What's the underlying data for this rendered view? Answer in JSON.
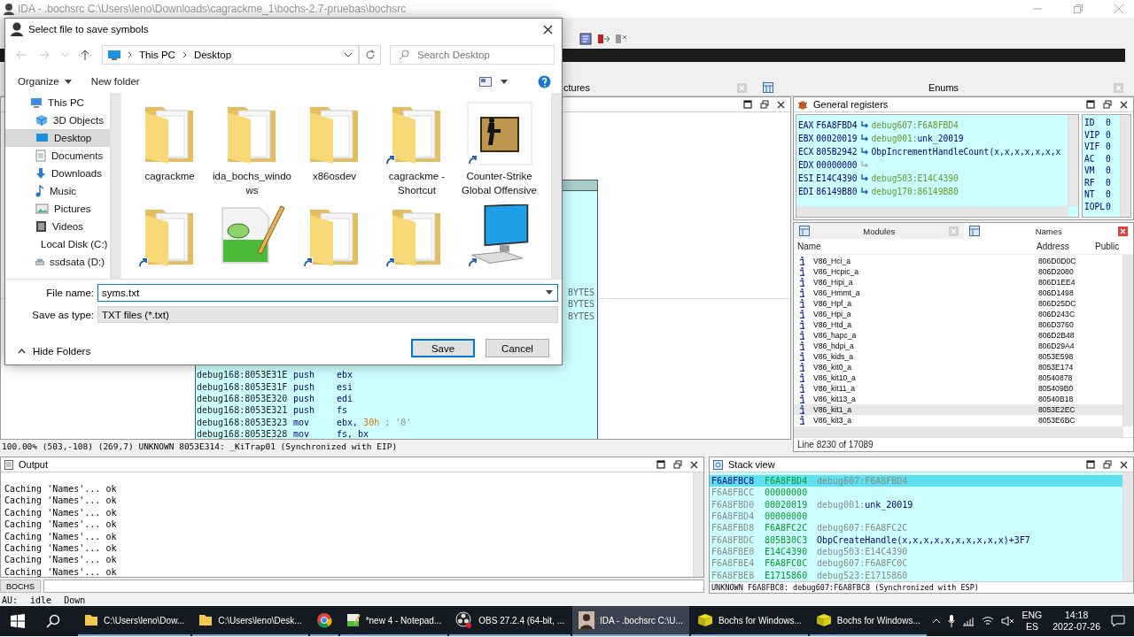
{
  "window": {
    "title": "IDA - .bochsrc C:\\Users\\leno\\Downloads\\cagrackme_1\\bochs-2.7-pruebas\\bochsrc"
  },
  "panel_tabs": [
    {
      "label": "ctures"
    },
    {
      "label": "Enums"
    }
  ],
  "disassembly": {
    "bytes_lines": [
      "BYTES",
      "BYTES",
      "BYTES"
    ],
    "lines": [
      {
        "address": "debug168:8053E31E",
        "mnemonic": "push",
        "operands": "ebx"
      },
      {
        "address": "debug168:8053E31F",
        "mnemonic": "push",
        "operands": "esi"
      },
      {
        "address": "debug168:8053E320",
        "mnemonic": "push",
        "operands": "edi"
      },
      {
        "address": "debug168:8053E321",
        "mnemonic": "push",
        "operands": "fs"
      },
      {
        "address": "debug168:8053E323",
        "mnemonic": "mov",
        "operands": "ebx, ",
        "immediate": "30h",
        "comment": " ; '0'"
      },
      {
        "address": "debug168:8053E328",
        "mnemonic": "mov",
        "operands": "fs, bx"
      }
    ],
    "status": "100.00% (503,-108) (269,7) UNKNOWN 8053E314: _KiTrap01 (Synchronized with EIP)"
  },
  "registers": {
    "title": "General registers",
    "rows": [
      {
        "name": "EAX",
        "value": "F6A8FBD4",
        "ref": [
          {
            "text": "debug607:F6A8FBD4",
            "kind": "data"
          }
        ]
      },
      {
        "name": "EBX",
        "value": "00020019",
        "ref": [
          {
            "text": "debug001:",
            "kind": "data"
          },
          {
            "text": "unk_20019",
            "kind": "name"
          }
        ]
      },
      {
        "name": "ECX",
        "value": "805B2942",
        "ref": [
          {
            "text": "ObpIncrementHandleCount(x,x,x,x,x,x,x",
            "kind": "name"
          }
        ]
      },
      {
        "name": "EDX",
        "value": "00000000",
        "ref": []
      },
      {
        "name": "ESI",
        "value": "E14C4390",
        "ref": [
          {
            "text": "debug503:E14C4390",
            "kind": "data"
          }
        ]
      },
      {
        "name": "EDI",
        "value": "86149B80",
        "ref": [
          {
            "text": "debug170:86149B80",
            "kind": "data"
          }
        ]
      }
    ],
    "flags": [
      {
        "name": "ID",
        "value": "0"
      },
      {
        "name": "VIP",
        "value": "0"
      },
      {
        "name": "VIF",
        "value": "0"
      },
      {
        "name": "AC",
        "value": "0"
      },
      {
        "name": "VM",
        "value": "0"
      },
      {
        "name": "RF",
        "value": "0"
      },
      {
        "name": "NT",
        "value": "0"
      },
      {
        "name": "IOPL",
        "value": "0"
      }
    ]
  },
  "names_view": {
    "tabs": [
      {
        "label": "Modules",
        "selected": false
      },
      {
        "label": "Names",
        "selected": true
      }
    ],
    "columns": [
      "Name",
      "Address",
      "Public"
    ],
    "rows": [
      {
        "name": "V86_Hci_a",
        "address": "806D0D0C",
        "selected": false
      },
      {
        "name": "V86_Hcpic_a",
        "address": "806D2080",
        "selected": false
      },
      {
        "name": "V86_Hipi_a",
        "address": "806D1EE4",
        "selected": false
      },
      {
        "name": "V86_Hmmt_a",
        "address": "806D1498",
        "selected": false
      },
      {
        "name": "V86_Hpf_a",
        "address": "806D25DC",
        "selected": false
      },
      {
        "name": "V86_Hpi_a",
        "address": "806D243C",
        "selected": false
      },
      {
        "name": "V86_Htd_a",
        "address": "806D3760",
        "selected": false
      },
      {
        "name": "V86_hapc_a",
        "address": "806D2B48",
        "selected": false
      },
      {
        "name": "V86_hdpi_a",
        "address": "806D29A4",
        "selected": false
      },
      {
        "name": "V86_kids_a",
        "address": "8053E598",
        "selected": false
      },
      {
        "name": "V86_kit0_a",
        "address": "8053E174",
        "selected": false
      },
      {
        "name": "V86_kit10_a",
        "address": "80540878",
        "selected": false
      },
      {
        "name": "V86_kit11_a",
        "address": "805409B0",
        "selected": false
      },
      {
        "name": "V86_kit13_a",
        "address": "80540B18",
        "selected": false
      },
      {
        "name": "V86_kit1_a",
        "address": "8053E2EC",
        "selected": true
      },
      {
        "name": "V86_kit3_a",
        "address": "8053E6BC",
        "selected": false
      }
    ],
    "status": "Line 8230 of 17089"
  },
  "output": {
    "title": "Output",
    "lines": [
      "Caching 'Names'... ok",
      "Caching 'Names'... ok",
      "Caching 'Names'... ok",
      "Caching 'Names'... ok",
      "Caching 'Names'... ok",
      "Caching 'Names'... ok",
      "Caching 'Names'... ok",
      "Caching 'Names'... ok"
    ],
    "command_label": "BOCHS"
  },
  "stack_view": {
    "title": "Stack view",
    "rows": [
      {
        "address": "F6A8FBC8",
        "value": "F6A8FBD4",
        "ref": [
          {
            "text": "debug607:F6A8FBD4",
            "kind": "data"
          }
        ],
        "selected": true
      },
      {
        "address": "F6A8FBCC",
        "value": "00000000",
        "ref": [],
        "selected": false
      },
      {
        "address": "F6A8FBD0",
        "value": "00020019",
        "ref": [
          {
            "text": "debug001:",
            "kind": "data"
          },
          {
            "text": "unk_20019",
            "kind": "name"
          }
        ],
        "selected": false
      },
      {
        "address": "F6A8FBD4",
        "value": "00000000",
        "ref": [],
        "selected": false
      },
      {
        "address": "F6A8FBD8",
        "value": "F6A8FC2C",
        "ref": [
          {
            "text": "debug607:F6A8FC2C",
            "kind": "data"
          }
        ],
        "selected": false
      },
      {
        "address": "F6A8FBDC",
        "value": "805B30C3",
        "ref": [
          {
            "text": "ObpCreateHandle(x,x,x,x,x,x,x,x,x,x)+3F7",
            "kind": "name"
          }
        ],
        "selected": false
      },
      {
        "address": "F6A8FBE0",
        "value": "E14C4390",
        "ref": [
          {
            "text": "debug503:E14C4390",
            "kind": "data"
          }
        ],
        "selected": false
      },
      {
        "address": "F6A8FBE4",
        "value": "F6A8FC0C",
        "ref": [
          {
            "text": "debug607:F6A8FC0C",
            "kind": "data"
          }
        ],
        "selected": false
      },
      {
        "address": "F6A8FBE8",
        "value": "E1715860",
        "ref": [
          {
            "text": "debug523:E1715860",
            "kind": "data"
          }
        ],
        "selected": false
      }
    ],
    "status": "UNKNOWN F6A8FBC8: debug607:F6A8FBC8 (Synchronized with ESP)"
  },
  "status_bar": {
    "items": [
      "AU:",
      "idle",
      "Down"
    ]
  },
  "dialog": {
    "title": "Select file to save symbols",
    "path": [
      "This PC",
      "Desktop"
    ],
    "search_placeholder": "Search Desktop",
    "organize": "Organize",
    "new_folder": "New folder",
    "tree": [
      {
        "label": "This PC",
        "selected": false,
        "children": [
          {
            "label": "3D Objects",
            "selected": false
          },
          {
            "label": "Desktop",
            "selected": true
          },
          {
            "label": "Documents",
            "selected": false
          },
          {
            "label": "Downloads",
            "selected": false
          },
          {
            "label": "Music",
            "selected": false
          },
          {
            "label": "Pictures",
            "selected": false
          },
          {
            "label": "Videos",
            "selected": false
          },
          {
            "label": "Local Disk (C:)",
            "selected": false
          },
          {
            "label": "ssdsata (D:)",
            "selected": false
          }
        ]
      }
    ],
    "files": [
      {
        "label": "cagrackme",
        "kind": "folder",
        "shortcut": false
      },
      {
        "label": "ida_bochs_windows",
        "kind": "folder",
        "shortcut": false
      },
      {
        "label": "x86osdev",
        "kind": "folder",
        "shortcut": false
      },
      {
        "label": "cagrackme - Shortcut",
        "kind": "folder",
        "shortcut": true
      },
      {
        "label": "Counter-Strike Global Offensive",
        "kind": "game",
        "shortcut": true
      },
      {
        "kind": "folder",
        "shortcut": true
      },
      {
        "kind": "text-file",
        "shortcut": false
      },
      {
        "kind": "folder",
        "shortcut": true
      },
      {
        "kind": "folder",
        "shortcut": true
      },
      {
        "kind": "computer",
        "shortcut": true
      }
    ],
    "file_name_label": "File name:",
    "file_name": "syms.txt",
    "type_label": "Save as type:",
    "type": "TXT files (*.txt)",
    "hide_folders": "Hide Folders",
    "buttons": [
      {
        "label": "Save",
        "default": true
      },
      {
        "label": "Cancel",
        "default": false
      }
    ]
  },
  "taskbar": {
    "tasks": [
      {
        "label": "C:\\Users\\leno\\Dow...",
        "kind": "folder",
        "selected": false
      },
      {
        "label": "C:\\Users\\leno\\Desk...",
        "kind": "folder",
        "selected": false
      },
      {
        "kind": "chrome",
        "selected": false
      },
      {
        "label": "*new 4 - Notepad...",
        "kind": "notepad",
        "selected": false
      },
      {
        "label": "OBS 27.2.4 (64-bit, ...",
        "kind": "obs",
        "selected": false
      },
      {
        "label": "IDA - .bochsrc C:\\U...",
        "kind": "ida",
        "selected": true
      },
      {
        "label": "Bochs for Windows...",
        "kind": "bochs",
        "selected": false
      },
      {
        "label": "Bochs for Windows...",
        "kind": "bochs",
        "selected": false
      }
    ],
    "language": [
      "ENG",
      "ES"
    ],
    "time": "14:18",
    "date": "2022-07-26"
  }
}
